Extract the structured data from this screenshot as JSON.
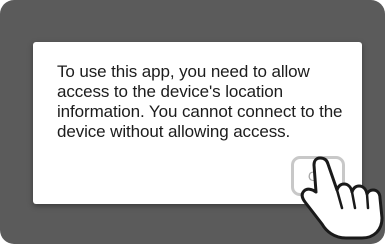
{
  "dialog": {
    "message": "To use this app, you need to allow access to the device's location information. You cannot connect to the device without allowing access.",
    "ok_label": "OK"
  },
  "icons": {
    "pointer": "pointing-hand-icon"
  },
  "colors": {
    "backdrop": "#5b5b5b",
    "dialog_background": "#ffffff",
    "text": "#1c1c1c",
    "button_border": "#c8c8c8",
    "button_text": "#a8a8a8"
  }
}
